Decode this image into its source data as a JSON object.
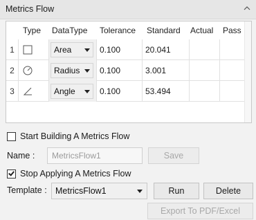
{
  "panel": {
    "title": "Metrics Flow",
    "collapse_icon": "chevron-up-icon"
  },
  "table": {
    "headers": [
      "Type",
      "DataType",
      "Tolerance",
      "Standard",
      "Actual",
      "Pass"
    ],
    "rows": [
      {
        "num": "1",
        "type_icon": "square-area-icon",
        "datatype": "Area",
        "tolerance": "0.100",
        "standard": "20.041",
        "actual": "",
        "pass": ""
      },
      {
        "num": "2",
        "type_icon": "circle-radius-icon",
        "datatype": "Radius",
        "tolerance": "0.100",
        "standard": "3.001",
        "actual": "",
        "pass": ""
      },
      {
        "num": "3",
        "type_icon": "angle-icon",
        "datatype": "Angle",
        "tolerance": "0.100",
        "standard": "53.494",
        "actual": "",
        "pass": ""
      }
    ]
  },
  "build": {
    "checkbox_label": "Start Building A Metrics Flow",
    "checked": false,
    "name_label": "Name :",
    "name_placeholder": "MetricsFlow1",
    "save_label": "Save"
  },
  "apply": {
    "checkbox_label": "Stop Applying A Metrics Flow",
    "checked": true,
    "template_label": "Template :",
    "template_value": "MetricsFlow1",
    "run_label": "Run",
    "delete_label": "Delete",
    "export_label": "Export To PDF/Excel"
  }
}
